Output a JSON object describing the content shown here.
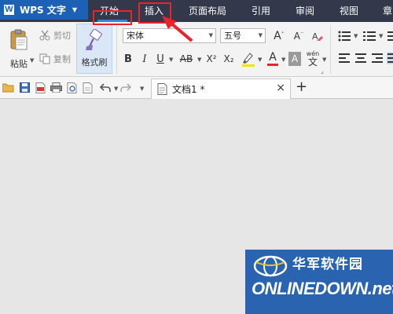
{
  "app": {
    "name": "WPS 文字",
    "logo": "W"
  },
  "menu": {
    "tabs": [
      {
        "label": "开始",
        "active": true
      },
      {
        "label": "插入"
      },
      {
        "label": "页面布局"
      },
      {
        "label": "引用"
      },
      {
        "label": "审阅"
      },
      {
        "label": "视图"
      },
      {
        "label": "章"
      }
    ]
  },
  "ribbon": {
    "paste": "粘贴",
    "cut": "剪切",
    "copy": "复制",
    "format_painter": "格式刷",
    "font_name": "宋体",
    "font_size": "五号",
    "bold": "B",
    "italic": "I",
    "underline": "U",
    "strikethrough": "AB",
    "superscript": "X²",
    "subscript": "X₂",
    "font_color": "A",
    "char_shading": "A",
    "phonetic_top": "wén",
    "phonetic_bottom": "文",
    "grow_font": "A",
    "shrink_font": "A"
  },
  "document": {
    "tab_title": "文档1 *",
    "close_symbol": "×",
    "new_tab_symbol": "+"
  },
  "watermark": {
    "title": "华军软件园",
    "brand": "ONLINEDOWN.net"
  },
  "colors": {
    "menubar": "#33384a",
    "app_button": "#1c61b5",
    "active_indicator": "#2e86e0",
    "annotation": "#e8232a",
    "highlight_yellow": "#f2e500",
    "font_color_red": "#e8232a",
    "watermark_bg": "#2a63b0"
  },
  "icons": [
    "paste-icon",
    "scissors-icon",
    "copy-icon",
    "format-painter-icon",
    "highlight-icon",
    "list-icon",
    "align-icon",
    "open-folder-icon",
    "save-icon",
    "pdf-icon",
    "print-icon",
    "preview-icon",
    "undo-icon",
    "redo-icon",
    "document-icon"
  ]
}
